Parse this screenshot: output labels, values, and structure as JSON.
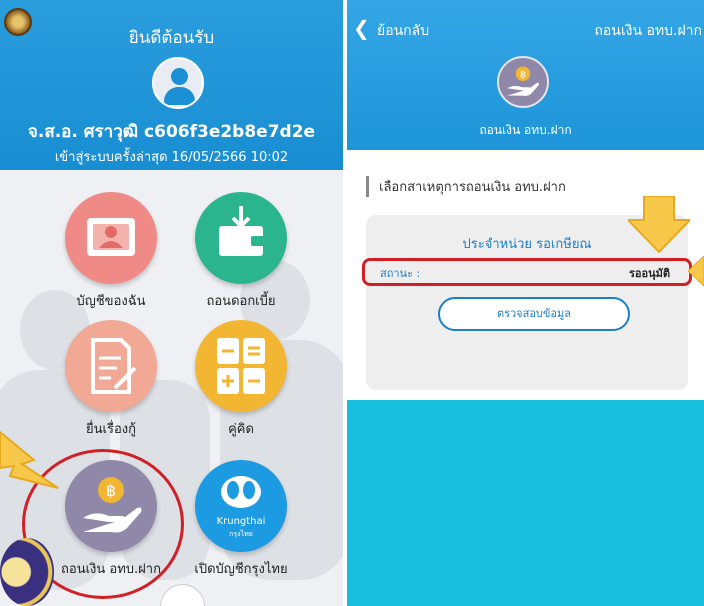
{
  "left": {
    "welcome": "ยินดีต้อนรับ",
    "user_name": "จ.ส.อ. ศราวุฒิ c606f3e2b8e7d2e",
    "last_login": "เข้าสู่ระบบครั้งล่าสุด 16/05/2566 10:02",
    "menu": [
      {
        "label": "บัญชีของฉัน",
        "icon": "id-card-icon",
        "color": "#ef8a86"
      },
      {
        "label": "ถอนดอกเบี้ย",
        "icon": "wallet-icon",
        "color": "#2bb58f"
      },
      {
        "label": "ยื่นเรื่องกู้",
        "icon": "document-edit-icon",
        "color": "#f1a894"
      },
      {
        "label": "คู่คิด",
        "icon": "calculator-icon",
        "color": "#f2b632"
      },
      {
        "label": "ถอนเงิน อทบ.ฝาก",
        "icon": "baht-coin-hand-icon",
        "color": "#8f88a8"
      },
      {
        "label": "เปิดบัญชีกรุงไทย",
        "icon": "krungthai-logo-icon",
        "color": "#1c9be2",
        "logo_text": "Krungthai",
        "logo_subtext": "กรุงไทย"
      }
    ]
  },
  "right": {
    "back_label": "ย้อนกลับ",
    "title": "ถอนเงิน อทบ.ฝาก",
    "header_caption": "ถอนเงิน อทบ.ฝาก",
    "select_reason": "เลือกสาเหตุการถอนเงิน อทบ.ฝาก",
    "unit": "ประจำหน่วย รอเกษียณ",
    "status_label": "สถานะ :",
    "status_value": "รออนุมัติ",
    "check_button": "ตรวจสอบข้อมูล"
  },
  "colors": {
    "header_blue": "#1d95d8",
    "highlight_red": "#d11f25",
    "arrow_yellow": "#f7c84a",
    "bottom_cyan": "#18bede"
  }
}
